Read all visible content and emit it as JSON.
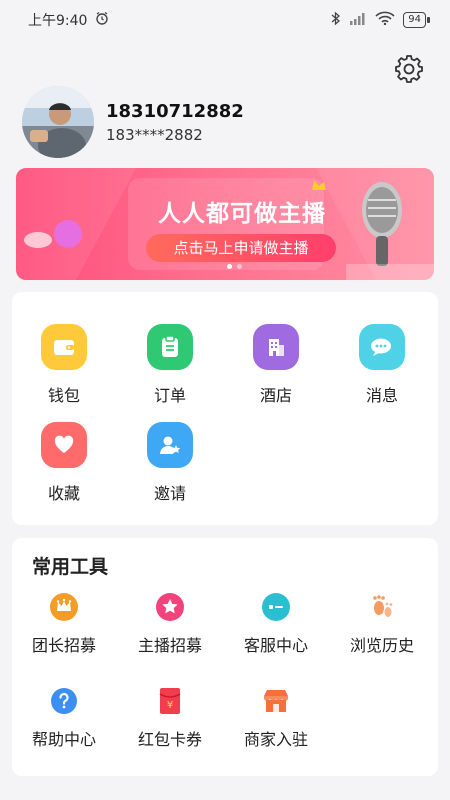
{
  "status_bar": {
    "time": "上午9:40",
    "battery": "94"
  },
  "profile": {
    "name": "18310712882",
    "phone_masked": "183****2882"
  },
  "banner": {
    "title": "人人都可做主播",
    "subtitle": "点击马上申请做主播"
  },
  "menu": [
    {
      "label": "钱包",
      "icon": "wallet-icon",
      "color": "#ffc93c"
    },
    {
      "label": "订单",
      "icon": "order-icon",
      "color": "#2ec972"
    },
    {
      "label": "酒店",
      "icon": "hotel-icon",
      "color": "#a06ae0"
    },
    {
      "label": "消息",
      "icon": "message-icon",
      "color": "#4fd2e6"
    },
    {
      "label": "收藏",
      "icon": "heart-icon",
      "color": "#ff6a6a"
    },
    {
      "label": "邀请",
      "icon": "invite-icon",
      "color": "#3fa8f5"
    }
  ],
  "tools": {
    "title": "常用工具",
    "items": [
      {
        "label": "团长招募",
        "icon": "crown-icon",
        "color": "#f39c26"
      },
      {
        "label": "主播招募",
        "icon": "star-icon",
        "color": "#f2447a"
      },
      {
        "label": "客服中心",
        "icon": "chat-icon",
        "color": "#29bfd0"
      },
      {
        "label": "浏览历史",
        "icon": "footprint-icon",
        "color": "#f79a5e"
      },
      {
        "label": "帮助中心",
        "icon": "help-icon",
        "color": "#3d8ef2"
      },
      {
        "label": "红包卡券",
        "icon": "redpacket-icon",
        "color": "#f23d4f"
      },
      {
        "label": "商家入驻",
        "icon": "shop-icon",
        "color": "#f76f3b"
      }
    ]
  }
}
